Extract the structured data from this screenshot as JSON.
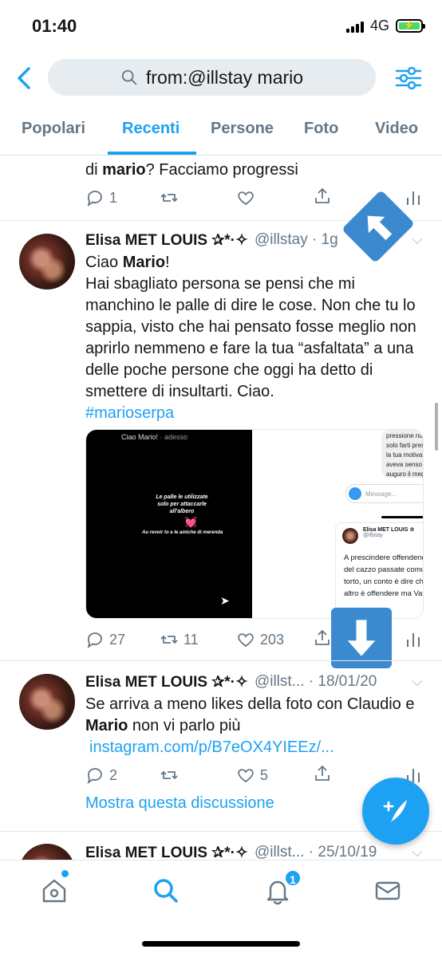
{
  "status": {
    "time": "01:40",
    "network": "4G"
  },
  "search": {
    "query": "from:@illstay mario"
  },
  "tabs": [
    "Popolari",
    "Recenti",
    "Persone",
    "Foto",
    "Video"
  ],
  "tweet0": {
    "text_pre": "di ",
    "text_bold": "mario",
    "text_post": "? Facciamo progressi",
    "replies": "1"
  },
  "tweet1": {
    "name": "Elisa MET LOUIS ✰*·✧",
    "handle": "@illstay · 1g",
    "greeting_pre": "Ciao ",
    "greeting_bold": "Mario",
    "greeting_post": "!",
    "body": "Hai sbagliato persona se pensi che mi manchino le palle di dire le cose. Non che tu lo sappia, visto che hai pensato fosse meglio non aprirlo nemmeno e fare la tua “asfaltata” a una delle poche persone che oggi ha detto di smettere di insultarti. Ciao.",
    "hashtag": "#marioserpa",
    "replies": "27",
    "retweets": "11",
    "likes": "203",
    "media": {
      "story_header": "Ciao Mario!",
      "story_time": "· adesso",
      "story_text": "Le palle le utilizzate solo per attaccarle all'albero",
      "story_sub": "Au revoir to e le amiche di merenda",
      "dm_text": "pressione nulla. Quindi niente, volevo solo farti presente che qualunque fosse la tua motivazione, questo gesto non aveva senso contro di me. Detto ciò, ti auguro il meglio 😊",
      "dm_placeholder": "Message...",
      "quote_name": "Elisa MET LOUIS ✰",
      "quote_handle": "@illstay",
      "quote_text": "A prescindere offendendo e scrivendo cose del cazzo passate comunque dalla parte del torto, un conto è dire che non fa ridere un altro è offendere ma Vabb"
    }
  },
  "tweet2": {
    "name": "Elisa MET LOUIS ✰*·✧",
    "handle": "@illst... · 18/01/20",
    "text_pre": "Se arriva a meno likes della foto con Claudio e ",
    "text_bold": "Mario",
    "text_post": " non vi parlo più",
    "link": "instagram.com/p/B7eOX4YIEEz/...",
    "replies": "2",
    "likes": "5",
    "thread": "Mostra questa discussione"
  },
  "tweet3": {
    "name": "Elisa MET LOUIS ✰*·✧",
    "handle": "@illst... · 25/10/19"
  },
  "nav": {
    "notifications_badge": "1"
  },
  "colors": {
    "accent": "#1da1f2",
    "annotation_arrow": "#3b8ad0"
  }
}
